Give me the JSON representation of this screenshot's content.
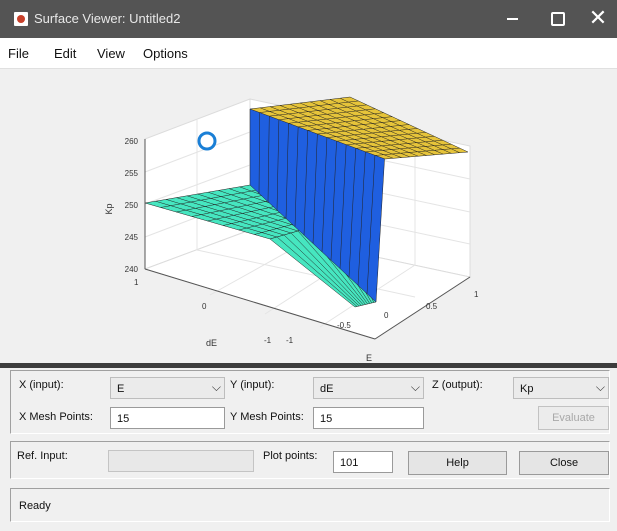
{
  "window": {
    "title": "Surface Viewer: Untitled2",
    "minimize_label": "–",
    "close_label": "✕"
  },
  "menu": [
    "File",
    "Edit",
    "View",
    "Options"
  ],
  "plot": {
    "z_label": "Kp",
    "x_label": "E",
    "y_label": "dE",
    "z_ticks": [
      "260",
      "255",
      "250",
      "245",
      "240"
    ],
    "x_ticks": [
      "-1",
      "-0.5",
      "0",
      "0.5",
      "1"
    ],
    "y_ticks": [
      "1",
      "0",
      "-1"
    ],
    "colors": {
      "high_plateau": "#e6c43a",
      "low_plateau": "#46e6c0",
      "wall": "#1f5fe0",
      "marker": "#1a7fd6"
    }
  },
  "controls": {
    "x_input_label": "X (input):",
    "x_input_value": "E",
    "y_input_label": "Y (input):",
    "y_input_value": "dE",
    "z_output_label": "Z (output):",
    "z_output_value": "Kp",
    "x_mesh_label": "X Mesh Points:",
    "x_mesh_value": "15",
    "y_mesh_label": "Y Mesh Points:",
    "y_mesh_value": "15",
    "evaluate_label": "Evaluate"
  },
  "row2": {
    "ref_input_label": "Ref. Input:",
    "ref_input_value": "",
    "plot_points_label": "Plot points:",
    "plot_points_value": "101",
    "help_label": "Help",
    "close_label": "Close"
  },
  "status": {
    "text": "Ready"
  }
}
